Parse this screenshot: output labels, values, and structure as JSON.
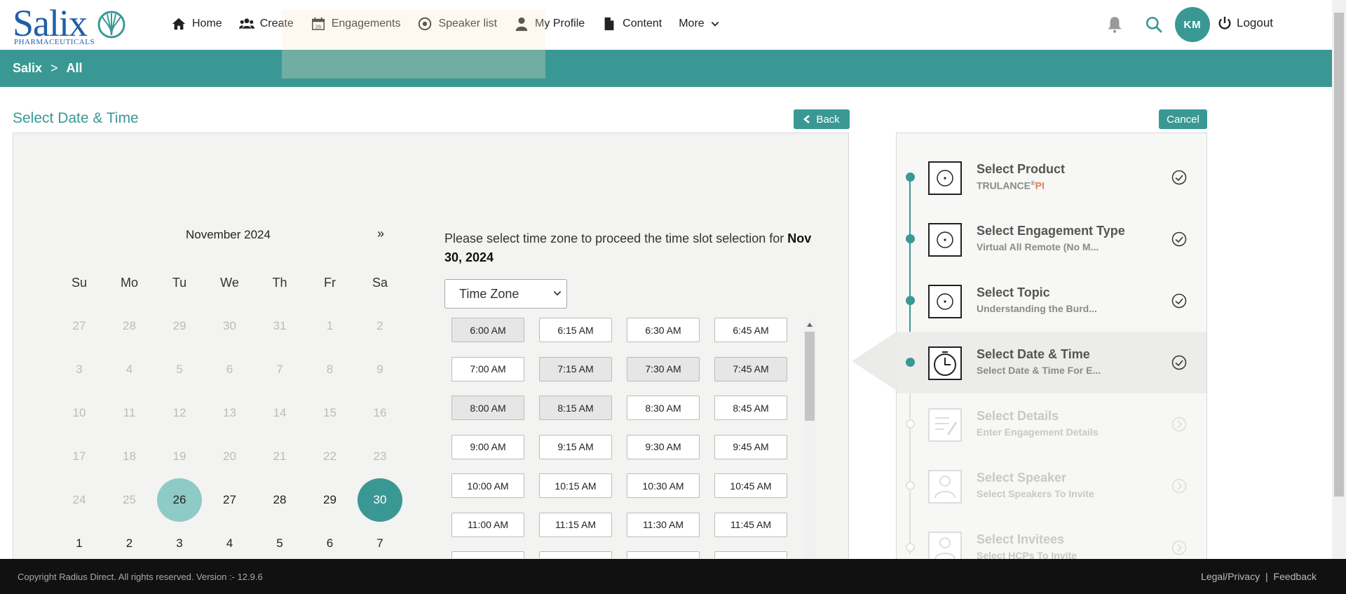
{
  "nav": {
    "logo_word": "Salix",
    "logo_sub": "PHARMACEUTICALS",
    "items": [
      {
        "label": "Home",
        "icon": "home-icon"
      },
      {
        "label": "Create",
        "icon": "users-icon"
      },
      {
        "label": "Engagements",
        "icon": "calendar-icon"
      },
      {
        "label": "Speaker list",
        "icon": "target-icon"
      },
      {
        "label": "My Profile",
        "icon": "user-icon"
      },
      {
        "label": "Content",
        "icon": "file-icon"
      },
      {
        "label": "More",
        "icon": "chevron-down-icon"
      }
    ],
    "avatar_initials": "KM",
    "logout_label": "Logout"
  },
  "breadcrumb": {
    "root": "Salix",
    "separator": ">",
    "current": "All"
  },
  "page": {
    "title": "Select Date & Time",
    "back_label": "Back",
    "cancel_label": "Cancel"
  },
  "calendar": {
    "month_label": "November 2024",
    "next_label": "»",
    "weekdays": [
      "Su",
      "Mo",
      "Tu",
      "We",
      "Th",
      "Fr",
      "Sa"
    ],
    "weeks": [
      [
        "27",
        "28",
        "29",
        "30",
        "31",
        "1",
        "2"
      ],
      [
        "3",
        "4",
        "5",
        "6",
        "7",
        "8",
        "9"
      ],
      [
        "10",
        "11",
        "12",
        "13",
        "14",
        "15",
        "16"
      ],
      [
        "17",
        "18",
        "19",
        "20",
        "21",
        "22",
        "23"
      ],
      [
        "24",
        "25",
        "26",
        "27",
        "28",
        "29",
        "30"
      ],
      [
        "1",
        "2",
        "3",
        "4",
        "5",
        "6",
        "7"
      ]
    ],
    "today": "26",
    "selected": "30"
  },
  "timezone": {
    "prompt": "Please select time zone to proceed the time slot selection for ",
    "date": "Nov 30, 2024",
    "select_value": "Time Zone"
  },
  "slots": [
    {
      "label": "6:00 AM",
      "disabled": true
    },
    {
      "label": "6:15 AM",
      "disabled": false
    },
    {
      "label": "6:30 AM",
      "disabled": false
    },
    {
      "label": "6:45 AM",
      "disabled": false
    },
    {
      "label": "7:00 AM",
      "disabled": false
    },
    {
      "label": "7:15 AM",
      "disabled": true
    },
    {
      "label": "7:30 AM",
      "disabled": true
    },
    {
      "label": "7:45 AM",
      "disabled": true
    },
    {
      "label": "8:00 AM",
      "disabled": true
    },
    {
      "label": "8:15 AM",
      "disabled": true
    },
    {
      "label": "8:30 AM",
      "disabled": false
    },
    {
      "label": "8:45 AM",
      "disabled": false
    },
    {
      "label": "9:00 AM",
      "disabled": false
    },
    {
      "label": "9:15 AM",
      "disabled": false
    },
    {
      "label": "9:30 AM",
      "disabled": false
    },
    {
      "label": "9:45 AM",
      "disabled": false
    },
    {
      "label": "10:00 AM",
      "disabled": false
    },
    {
      "label": "10:15 AM",
      "disabled": false
    },
    {
      "label": "10:30 AM",
      "disabled": false
    },
    {
      "label": "10:45 AM",
      "disabled": false
    },
    {
      "label": "11:00 AM",
      "disabled": false
    },
    {
      "label": "11:15 AM",
      "disabled": false
    },
    {
      "label": "11:30 AM",
      "disabled": false
    },
    {
      "label": "11:45 AM",
      "disabled": false
    }
  ],
  "steps": [
    {
      "title": "Select Product",
      "sub": "TRULANCE",
      "sub_sup": "®",
      "sub_pi": "PI",
      "state": "done"
    },
    {
      "title": "Select Engagement Type",
      "sub": "Virtual All Remote (No M...",
      "state": "done"
    },
    {
      "title": "Select Topic",
      "sub": "Understanding the Burd...",
      "state": "done"
    },
    {
      "title": "Select Date & Time",
      "sub": "Select Date & Time For E...",
      "state": "active"
    },
    {
      "title": "Select Details",
      "sub": "Enter Engagement Details",
      "state": "future"
    },
    {
      "title": "Select Speaker",
      "sub": "Select Speakers To Invite",
      "state": "future"
    },
    {
      "title": "Select Invitees",
      "sub": "Select HCPs To Invite",
      "state": "future"
    }
  ],
  "footer": {
    "copyright": "Copyright Radius Direct. All rights reserved. Version :- 12.9.6",
    "legal": "Legal/Privacy",
    "divider": "|",
    "feedback": "Feedback"
  },
  "colors": {
    "accent": "#3a9894",
    "today_bubble": "#8ecac6",
    "logo_blue": "#1f5fa6"
  }
}
